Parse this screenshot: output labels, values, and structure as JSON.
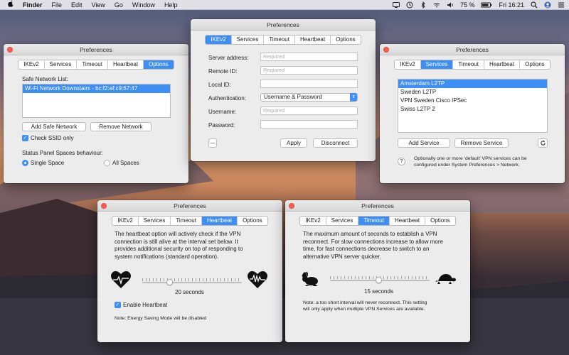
{
  "menubar": {
    "app_name": "Finder",
    "items": [
      "File",
      "Edit",
      "View",
      "Go",
      "Window",
      "Help"
    ],
    "battery": "75 %",
    "clock": "Fri 16:21"
  },
  "win_options": {
    "title": "Preferences",
    "tabs": [
      "IKEv2",
      "Services",
      "Timeout",
      "Heartbeat",
      "Options"
    ],
    "active_tab": "Options",
    "safe_network_label": "Safe Network List:",
    "safe_networks": [
      "Wi-Fi Network Downstairs - bc:f2:af:c9:67:47"
    ],
    "add_button": "Add Safe Network",
    "remove_button": "Remove Network",
    "check_ssid_label": "Check SSID only",
    "status_panel_label": "Status Panel Spaces behaviour:",
    "radio_single": "Single Space",
    "radio_all": "All Spaces"
  },
  "win_ikev2": {
    "title": "Preferences",
    "tabs": [
      "IKEv2",
      "Services",
      "Timeout",
      "Heartbeat",
      "Options"
    ],
    "active_tab": "IKEv2",
    "server_address_label": "Server address:",
    "server_address_placeholder": "Required",
    "remote_id_label": "Remote ID:",
    "remote_id_placeholder": "Required",
    "local_id_label": "Local ID:",
    "authentication_label": "Authentication:",
    "authentication_value": "Username & Password",
    "username_label": "Username:",
    "username_placeholder": "Required",
    "password_label": "Password:",
    "minus_button": "—",
    "apply_button": "Apply",
    "disconnect_button": "Disconnect"
  },
  "win_services": {
    "title": "Preferences",
    "tabs": [
      "IKEv2",
      "Services",
      "Timeout",
      "Heartbeat",
      "Options"
    ],
    "active_tab": "Services",
    "services": [
      "Amsterdam L2TP",
      "Sweden L2TP",
      "VPN Sweden Cisco IPSec",
      "Swiss L2TP 2"
    ],
    "selected_index": 0,
    "add_button": "Add Service",
    "remove_button": "Remove Service",
    "help_text_1": "Optionally one or more 'default' VPN services can be",
    "help_text_2": "configured under System Preferences > Network."
  },
  "win_heartbeat": {
    "title": "Preferences",
    "tabs": [
      "IKEv2",
      "Services",
      "Timeout",
      "Heartbeat",
      "Options"
    ],
    "active_tab": "Heartbeat",
    "description": [
      "The heartbeat option will actively check if the VPN",
      "connection is still alive at the interval set below. It",
      "provides additional security on top of responding to",
      "system notifications (standard operation)."
    ],
    "slider_value": 0.25,
    "slider_label": "20 seconds",
    "enable_label": "Enable Heartbeat",
    "note": "Note: Energy Saving Mode will be disabled"
  },
  "win_timeout": {
    "title": "Preferences",
    "tabs": [
      "IKEv2",
      "Services",
      "Timeout",
      "Heartbeat",
      "Options"
    ],
    "active_tab": "Timeout",
    "description": [
      "The maximum amount of seconds to establish a VPN",
      "reconnect. For slow connections increase to allow more",
      "time, for fast connections decrease to switch to an",
      "alternative VPN server quicker."
    ],
    "slider_value": 0.5,
    "slider_label": "15 seconds",
    "note_1": "Note: a too short interval will never reconnect. This setting",
    "note_2": "will only apply when multiple VPN Services are available."
  },
  "colors": {
    "accent": "#3d8ef5",
    "close": "#fb5f57"
  }
}
